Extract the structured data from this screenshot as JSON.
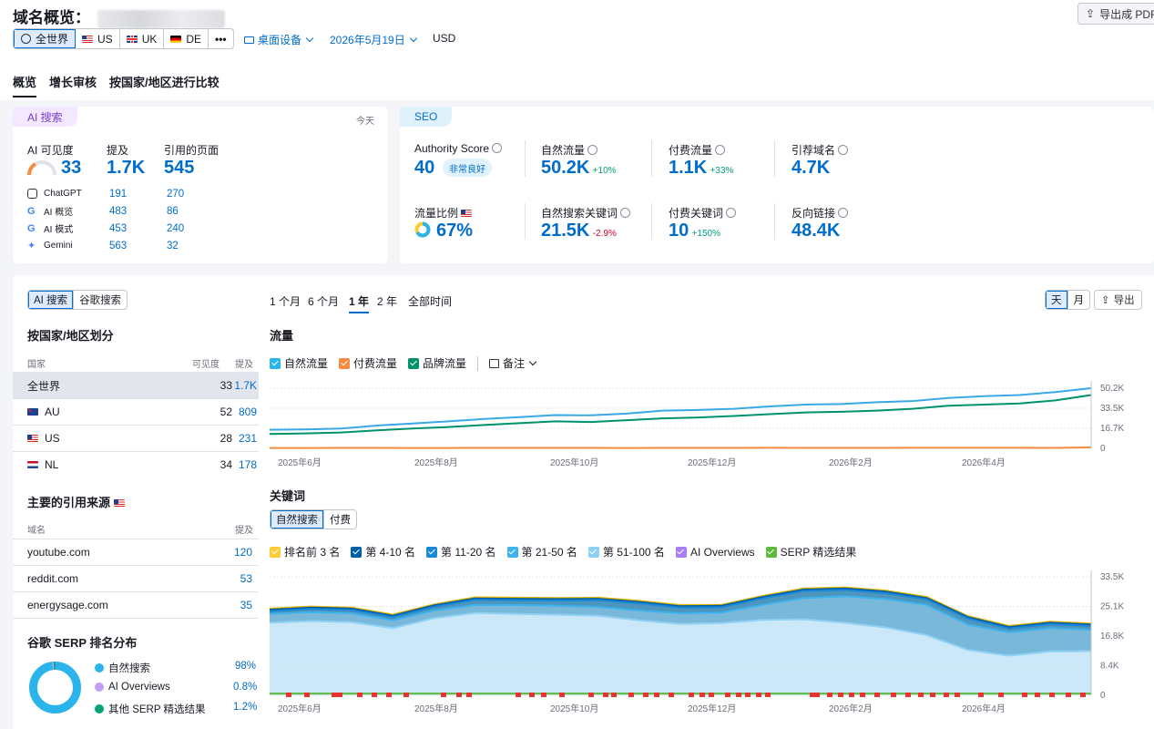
{
  "header": {
    "title": "域名概览：",
    "export_pdf": "导出成 PDF",
    "geo": [
      {
        "label": "全世界",
        "flag": "globe",
        "active": true
      },
      {
        "label": "US",
        "flag": "us"
      },
      {
        "label": "UK",
        "flag": "uk"
      },
      {
        "label": "DE",
        "flag": "de"
      },
      {
        "label": "•••",
        "flag": "none"
      }
    ],
    "device": "桌面设备",
    "date": "2026年5月19日",
    "currency": "USD"
  },
  "tabs": [
    "概览",
    "增长审核",
    "按国家/地区进行比较"
  ],
  "ai_card": {
    "tag": "AI 搜索",
    "today": "今天",
    "visibility_label": "AI 可见度",
    "visibility_value": "33",
    "mentions_label": "提及",
    "mentions_value": "1.7K",
    "cited_label": "引用的页面",
    "cited_value": "545",
    "rows": [
      {
        "name": "ChatGPT",
        "icon": "chatgpt-icon",
        "mentions": "191",
        "cited": "270"
      },
      {
        "name": "AI 概览",
        "icon": "google-icon",
        "mentions": "483",
        "cited": "86"
      },
      {
        "name": "AI 模式",
        "icon": "google-icon",
        "mentions": "453",
        "cited": "240"
      },
      {
        "name": "Gemini",
        "icon": "gemini-icon",
        "mentions": "563",
        "cited": "32"
      }
    ]
  },
  "seo_card": {
    "tag": "SEO",
    "authority_label": "Authority Score",
    "authority_value": "40",
    "authority_badge": "非常良好",
    "organic_label": "自然流量",
    "organic_value": "50.2K",
    "organic_delta": "+10%",
    "paid_label": "付费流量",
    "paid_value": "1.1K",
    "paid_delta": "+33%",
    "ref_label": "引荐域名",
    "ref_value": "4.7K",
    "share_label": "流量比例",
    "share_value": "67%",
    "share_fraction": 0.67,
    "kw_label": "自然搜索关键词",
    "kw_value": "21.5K",
    "kw_delta": "-2.9%",
    "paid_kw_label": "付费关键词",
    "paid_kw_value": "10",
    "paid_kw_delta": "+150%",
    "backlinks_label": "反向链接",
    "backlinks_value": "48.4K"
  },
  "left": {
    "search_tabs": [
      "AI 搜索",
      "谷歌搜索"
    ],
    "country_title": "按国家/地区划分",
    "col_country": "国家",
    "col_visibility": "可见度",
    "col_mentions": "提及",
    "countries": [
      {
        "name": "全世界",
        "flag": "none",
        "visibility": "33",
        "mentions": "1.7K"
      },
      {
        "name": "AU",
        "flag": "au",
        "visibility": "52",
        "mentions": "809"
      },
      {
        "name": "US",
        "flag": "us",
        "visibility": "28",
        "mentions": "231"
      },
      {
        "name": "NL",
        "flag": "nl",
        "visibility": "34",
        "mentions": "178"
      }
    ],
    "sources_title": "主要的引用来源",
    "col_domain": "域名",
    "col_mentions2": "提及",
    "sources": [
      {
        "domain": "youtube.com",
        "mentions": "120"
      },
      {
        "domain": "reddit.com",
        "mentions": "53"
      },
      {
        "domain": "energysage.com",
        "mentions": "35"
      }
    ],
    "serp_title": "谷歌 SERP 排名分布",
    "serp_items": [
      {
        "label": "自然搜索",
        "value": "98%",
        "color": "#2bb3ec"
      },
      {
        "label": "AI Overviews",
        "value": "0.8%",
        "color": "#c39df5"
      },
      {
        "label": "其他 SERP 精选结果",
        "value": "1.2%",
        "color": "#00a37a"
      }
    ]
  },
  "main": {
    "periods": [
      "1 个月",
      "6 个月",
      "1 年",
      "2 年",
      "全部时间"
    ],
    "active_period": 2,
    "day": "天",
    "month": "月",
    "export": "导出",
    "traffic_title": "流量",
    "traffic_legend": [
      {
        "label": "自然流量",
        "color": "#2bb3ec"
      },
      {
        "label": "付费流量",
        "color": "#f68c3f"
      },
      {
        "label": "品牌流量",
        "color": "#00936b"
      }
    ],
    "notes": "备注",
    "keywords_title": "关键词",
    "kw_tabs": [
      "自然搜索",
      "付费"
    ],
    "kw_legend": [
      {
        "label": "排名前 3 名",
        "color": "#ffcc33"
      },
      {
        "label": "第 4-10 名",
        "color": "#005fa8"
      },
      {
        "label": "第 11-20 名",
        "color": "#1a88d8"
      },
      {
        "label": "第 21-50 名",
        "color": "#3db2ed"
      },
      {
        "label": "第 51-100 名",
        "color": "#8fd1f5"
      },
      {
        "label": "AI Overviews",
        "color": "#a97ef0"
      },
      {
        "label": "SERP 精选结果",
        "color": "#5cba3c"
      }
    ]
  },
  "chart_data": [
    {
      "type": "line",
      "title": "流量",
      "x_ticks": [
        "2025年6月",
        "2025年8月",
        "2025年10月",
        "2025年12月",
        "2026年2月",
        "2026年4月"
      ],
      "y_ticks": [
        "50.2K",
        "33.5K",
        "16.7K",
        "0"
      ],
      "ylim": [
        0,
        50200
      ],
      "series": [
        {
          "name": "自然流量",
          "values": [
            15500,
            15800,
            16500,
            19000,
            20800,
            22500,
            24500,
            26000,
            27800,
            27500,
            29000,
            31500,
            32000,
            33000,
            35000,
            36500,
            37000,
            38500,
            39500,
            42000,
            43500,
            44500,
            47000,
            50200
          ]
        },
        {
          "name": "品牌流量",
          "values": [
            12000,
            12500,
            13200,
            15000,
            16500,
            17800,
            19500,
            21000,
            22500,
            22000,
            23500,
            25000,
            25800,
            27000,
            28500,
            30000,
            30500,
            31500,
            33000,
            35500,
            36500,
            37500,
            40000,
            44500
          ]
        },
        {
          "name": "付费流量",
          "values": [
            300,
            300,
            350,
            350,
            300,
            320,
            350,
            400,
            380,
            360,
            340,
            350,
            380,
            400,
            420,
            400,
            380,
            400,
            420,
            450,
            430,
            420,
            400,
            800
          ]
        }
      ]
    },
    {
      "type": "area",
      "title": "关键词",
      "x_ticks": [
        "2025年6月",
        "2025年8月",
        "2025年10月",
        "2025年12月",
        "2026年2月",
        "2026年4月"
      ],
      "y_ticks": [
        "33.5K",
        "25.1K",
        "16.8K",
        "8.4K",
        "0"
      ],
      "ylim": [
        0,
        33500
      ],
      "series": [
        {
          "name": "排名前 3 名",
          "values": [
            24500,
            25100,
            24800,
            22800,
            25700,
            27700,
            27600,
            27500,
            27600,
            26700,
            25500,
            25600,
            28100,
            30200,
            30500,
            29600,
            27800,
            22400,
            19600,
            20800,
            20300
          ]
        },
        {
          "name": "第 4-10 名",
          "values": [
            24200,
            24800,
            24500,
            22500,
            25400,
            27400,
            27300,
            27200,
            27300,
            26400,
            25200,
            25300,
            27800,
            29900,
            30200,
            29300,
            27500,
            22100,
            19300,
            20500,
            20000
          ]
        },
        {
          "name": "第 11-20 名",
          "values": [
            23800,
            24400,
            24100,
            22100,
            25000,
            27000,
            26900,
            26800,
            26900,
            26000,
            24800,
            24900,
            27400,
            29500,
            29800,
            28900,
            27100,
            21700,
            18900,
            20100,
            19600
          ]
        },
        {
          "name": "第 21-50 名",
          "values": [
            23000,
            23500,
            23200,
            21200,
            24000,
            25500,
            25500,
            25300,
            25000,
            24000,
            23200,
            23400,
            25600,
            27500,
            28000,
            27200,
            25600,
            20000,
            17800,
            19000,
            18500
          ]
        },
        {
          "name": "第 51-100 名",
          "values": [
            20500,
            21000,
            20700,
            19000,
            21800,
            23300,
            23000,
            22800,
            22500,
            21200,
            20200,
            20400,
            21300,
            21500,
            20500,
            19200,
            17000,
            12800,
            11200,
            12400,
            12500
          ]
        },
        {
          "name": "SERP 精选结果",
          "values": [
            500,
            500,
            500,
            500,
            500,
            500,
            500,
            500,
            500,
            500,
            500,
            500,
            500,
            500,
            500,
            500,
            500,
            500,
            500,
            500,
            500
          ]
        }
      ]
    },
    {
      "type": "pie",
      "title": "谷歌 SERP 排名分布",
      "labels": [
        "自然搜索",
        "AI Overviews",
        "其他 SERP 精选结果"
      ],
      "values": [
        98,
        0.8,
        1.2
      ]
    }
  ]
}
